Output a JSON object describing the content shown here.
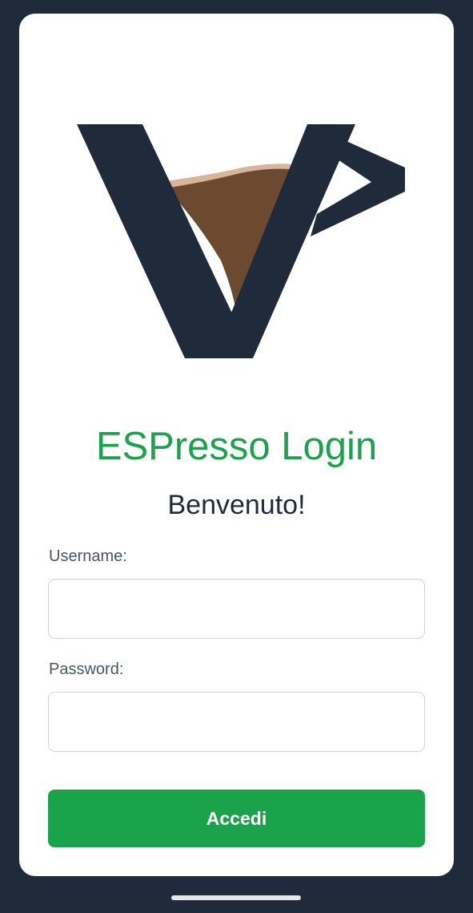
{
  "app": {
    "logo_icon": "espresso-cup-v-logo",
    "colors": {
      "background": "#1f2a3b",
      "accent": "#1aa34a",
      "coffee": "#6b4a2f",
      "crema": "#d8b49a"
    }
  },
  "login": {
    "title": "ESPresso Login",
    "welcome": "Benvenuto!",
    "username_label": "Username:",
    "username_value": "",
    "password_label": "Password:",
    "password_value": "",
    "submit_label": "Accedi"
  }
}
